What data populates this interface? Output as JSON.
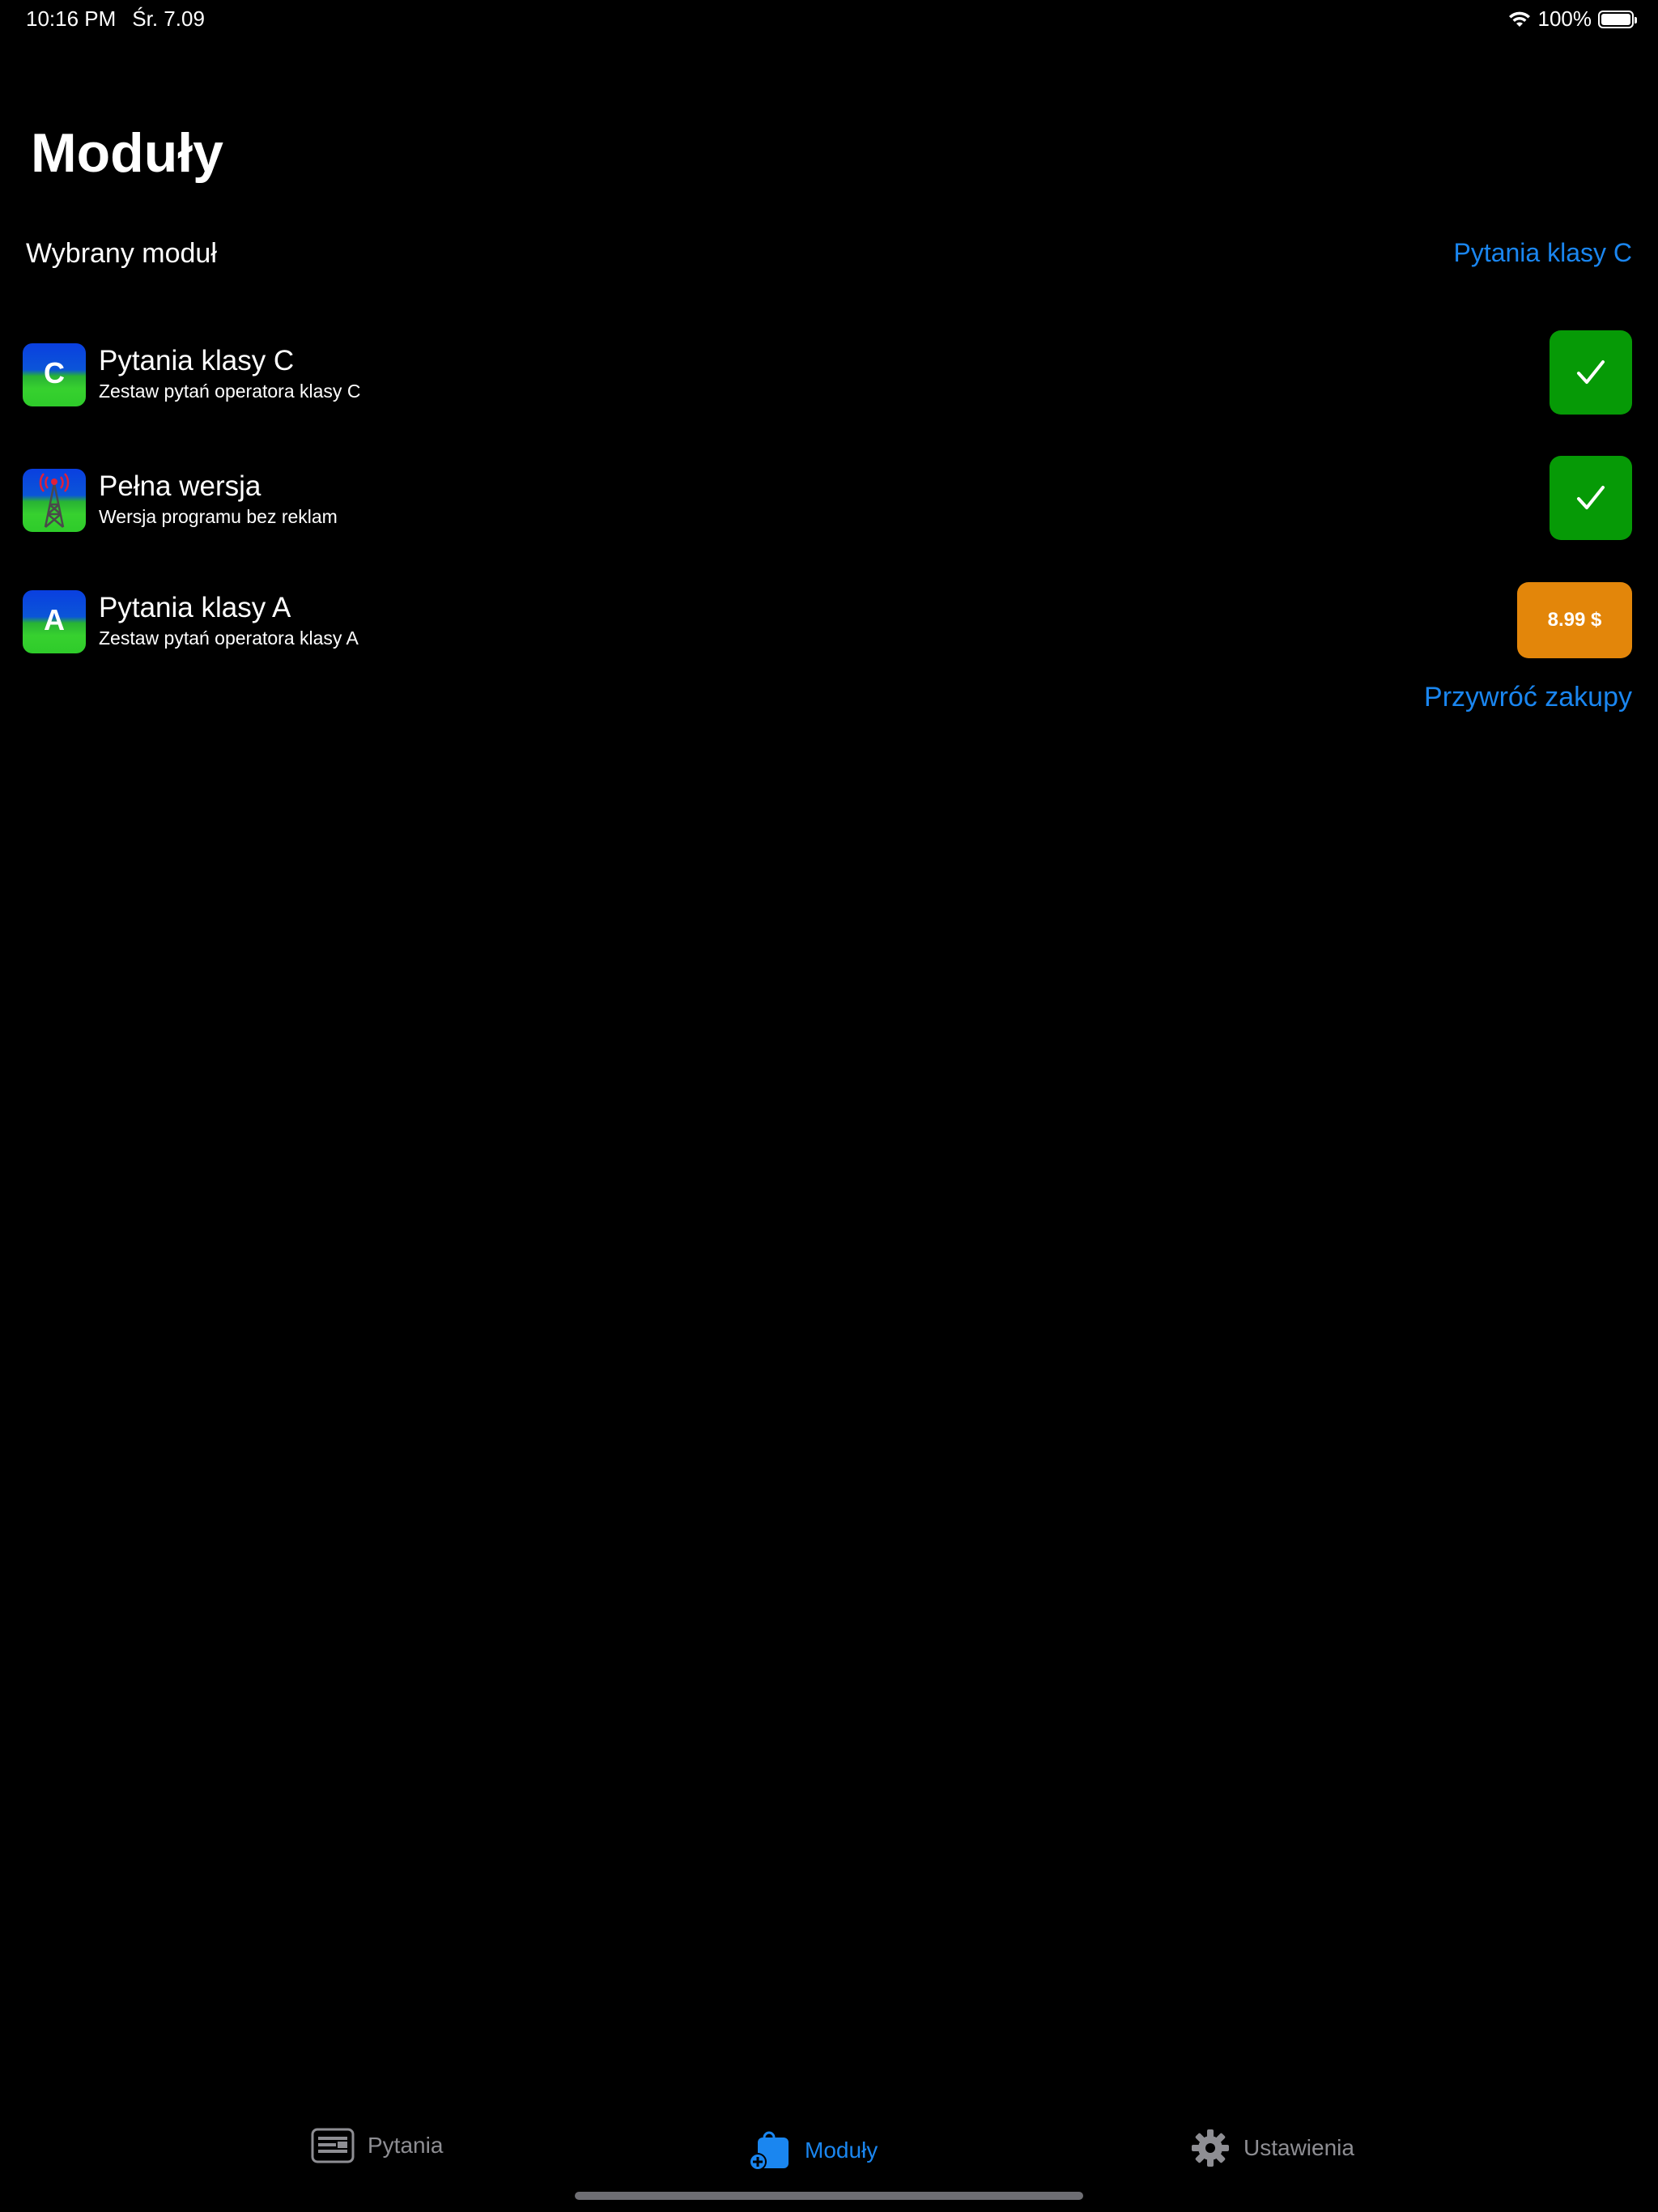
{
  "status_bar": {
    "time": "10:16 PM",
    "date": "Śr. 7.09",
    "battery": "100%",
    "battery_level": 1.0,
    "icons": [
      "wifi-icon",
      "battery-icon"
    ]
  },
  "page_title": "Moduły",
  "selected_module": {
    "label": "Wybrany moduł",
    "value": "Pytania klasy C"
  },
  "modules": [
    {
      "name": "Pytania klasy C",
      "description": "Zestaw pytań operatora klasy C",
      "icon": "class-c-icon",
      "icon_letter": "C",
      "action": "purchased-check",
      "action_color": "#069a06"
    },
    {
      "name": "Pełna wersja",
      "description": "Wersja programu bez reklam",
      "icon": "radio-tower-icon",
      "action": "purchased-check",
      "action_color": "#069a06"
    },
    {
      "name": "Pytania klasy A",
      "description": "Zestaw pytań operatora klasy A",
      "icon": "class-a-icon",
      "icon_letter": "A",
      "action": "price",
      "price": "8.99 $",
      "action_color": "#e3860a"
    }
  ],
  "restore_purchases": "Przywróć zakupy",
  "tabs": [
    {
      "label": "Pytania",
      "icon": "questions-icon",
      "active": false
    },
    {
      "label": "Moduły",
      "icon": "modules-bag-icon",
      "active": true
    },
    {
      "label": "Ustawienia",
      "icon": "gear-icon",
      "active": false
    }
  ],
  "colors": {
    "background": "#000000",
    "accent": "#1a86f0",
    "purchased": "#069a06",
    "price": "#e3860a",
    "inactive_tab": "#8e8e93"
  }
}
